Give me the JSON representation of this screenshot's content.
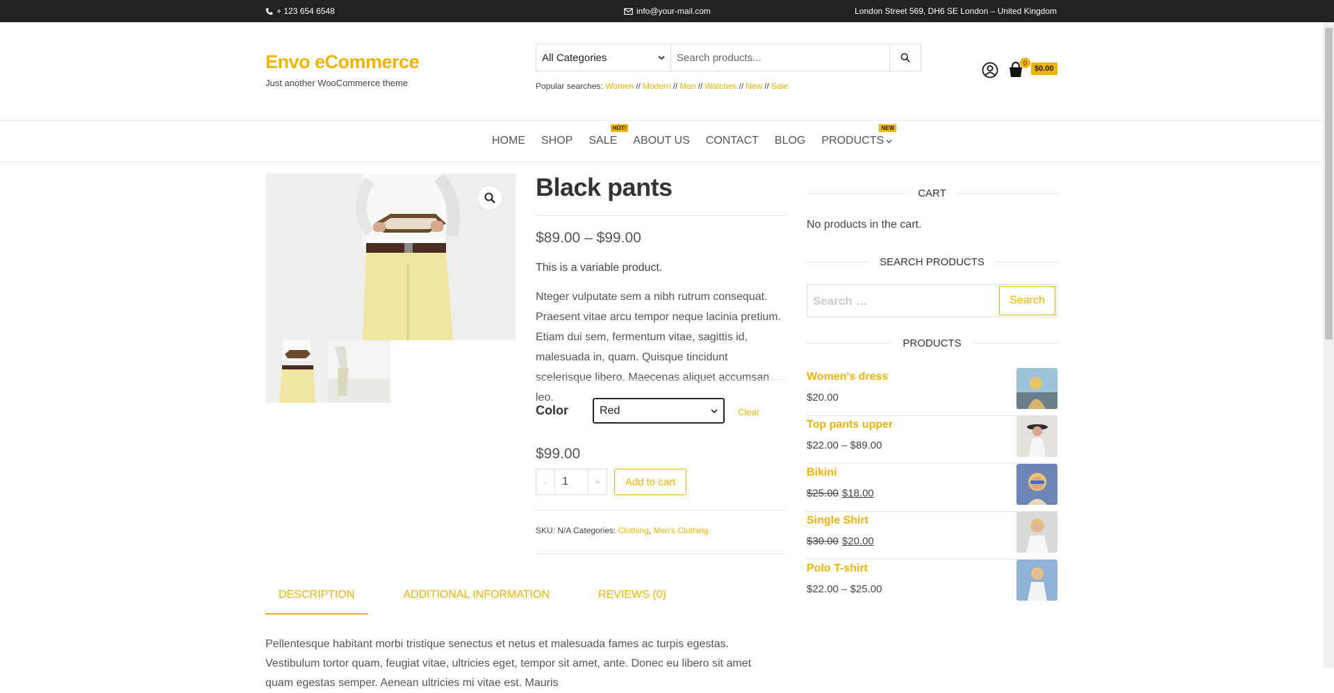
{
  "topbar": {
    "phone": "+ 123 654 6548",
    "email": "info@your-mail.com",
    "address": "London Street 569, DH6 SE London – United Kingdom"
  },
  "brand": {
    "title": "Envo eCommerce",
    "tagline": "Just another WooCommerce theme",
    "accent": "#f0b400"
  },
  "search": {
    "category": "All Categories",
    "placeholder": "Search products...",
    "popular_label": "Popular searches:",
    "popular_terms": [
      "Women",
      "Modern",
      "Men",
      "Watches",
      "New",
      "Sale"
    ],
    "separator": "//"
  },
  "header_cart": {
    "count": "0",
    "total": "$0.00"
  },
  "nav": {
    "items": [
      {
        "label": "HOME"
      },
      {
        "label": "SHOP"
      },
      {
        "label": "SALE",
        "badge": "HOT!"
      },
      {
        "label": "ABOUT US"
      },
      {
        "label": "CONTACT"
      },
      {
        "label": "BLOG"
      },
      {
        "label": "PRODUCTS",
        "badge": "NEW"
      }
    ]
  },
  "product": {
    "title": "Black pants",
    "price_range": "$89.00 – $99.00",
    "short_description": "This is a variable product.",
    "description": "Nteger vulputate sem a nibh rutrum consequat. Praesent vitae arcu tempor neque lacinia pretium. Etiam dui sem, fermentum vitae, sagittis id, malesuada in, quam. Quisque tincidunt scelerisque libero. Maecenas aliquet accumsan leo.",
    "variation_label": "Color",
    "variation_value": "Red",
    "clear_label": "Clear",
    "variation_price": "$99.00",
    "qty_minus": "-",
    "quantity": "1",
    "qty_plus": "+",
    "add_to_cart": "Add to cart",
    "meta_sku": "SKU: N/A Categories:",
    "categories": [
      "Clothing",
      "Men's Clothing"
    ],
    "category_separator": ","
  },
  "tabs": {
    "items": [
      "DESCRIPTION",
      "ADDITIONAL INFORMATION",
      "REVIEWS (0)"
    ],
    "content": "Pellentesque habitant morbi tristique senectus et netus et malesuada fames ac turpis egestas. Vestibulum tortor quam, feugiat vitae, ultricies eget, tempor sit amet, ante. Donec eu libero sit amet quam egestas semper. Aenean ultricies mi vitae est. Mauris"
  },
  "sidebar": {
    "cart_title": "CART",
    "cart_empty": "No products in the cart.",
    "search_title": "SEARCH PRODUCTS",
    "search_placeholder": "Search …",
    "search_button": "Search",
    "products_title": "PRODUCTS",
    "products": [
      {
        "name": "Women's dress",
        "price": "$20.00"
      },
      {
        "name": "Top pants upper",
        "price": "$22.00 – $89.00"
      },
      {
        "name": "Bikini",
        "old_price": "$25.00",
        "price": "$18.00"
      },
      {
        "name": "Single Shirt",
        "old_price": "$30.00",
        "price": "$20.00"
      },
      {
        "name": "Polo T-shirt",
        "price": "$22.00 – $25.00"
      }
    ]
  }
}
